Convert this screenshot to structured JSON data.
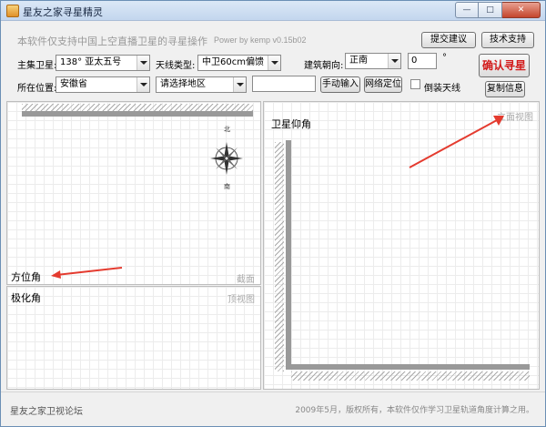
{
  "window": {
    "title": "星友之家寻星精灵",
    "controls": {
      "minimize": "—",
      "maximize": "□",
      "close": "✕"
    }
  },
  "header": {
    "slogan": "本软件仅支持中国上空直播卫星的寻星操作",
    "power": "Power by kemp  v0.15b02",
    "feedback_button": "提交建议",
    "support_button": "技术支持",
    "confirm_button": "确认寻星",
    "copy_button": "复制信息"
  },
  "form": {
    "satellite_label": "主集卫星:",
    "satellite_value": "138°  亚太五号",
    "antenna_label": "天线类型:",
    "antenna_value": "中卫60cm偏馈",
    "building_label": "建筑朝向:",
    "building_value": "正南",
    "angle_value": "0",
    "angle_unit": "°",
    "location_label": "所在位置:",
    "province_value": "安徽省",
    "region_value": "请选择地区",
    "manual_input": "",
    "manual_button": "手动输入",
    "network_button": "网络定位",
    "invert_label": "倒装天线",
    "invert_checked": false
  },
  "panels": {
    "azimuth": {
      "label": "方位角",
      "corner": "截面"
    },
    "elevation_small": {
      "label": "极化角",
      "corner": "顶视图"
    },
    "elevation": {
      "label": "卫星仰角",
      "corner": "立面视图"
    },
    "compass": {
      "north": "北",
      "south": "南"
    }
  },
  "status": {
    "left": "星友之家卫视论坛",
    "right": "2009年5月，版权所有，本软件仅作学习卫星轨道角度计算之用。"
  }
}
